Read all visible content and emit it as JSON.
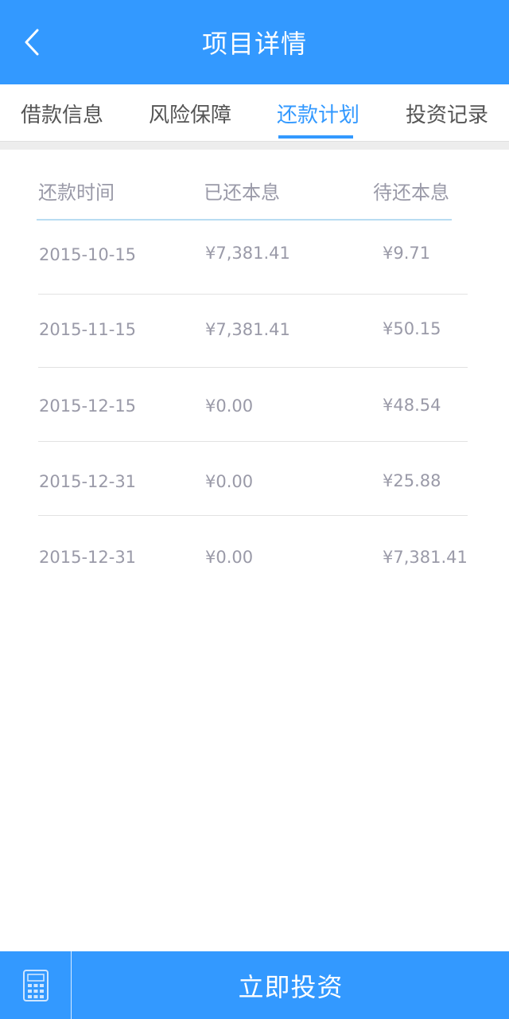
{
  "header": {
    "title": "项目详情",
    "back_icon": "chevron-left-icon"
  },
  "tabs": [
    {
      "label": "借款信息",
      "active": false
    },
    {
      "label": "风险保障",
      "active": false
    },
    {
      "label": "还款计划",
      "active": true
    },
    {
      "label": "投资记录",
      "active": false
    }
  ],
  "table": {
    "columns": [
      "还款时间",
      "已还本息",
      "待还本息"
    ],
    "rows": [
      {
        "date": "2015-10-15",
        "paid": "¥7,381.41",
        "pending": "¥9.71"
      },
      {
        "date": "2015-11-15",
        "paid": "¥7,381.41",
        "pending": "¥50.15"
      },
      {
        "date": "2015-12-15",
        "paid": "¥0.00",
        "pending": "¥48.54"
      },
      {
        "date": "2015-12-31",
        "paid": "¥0.00",
        "pending": "¥25.88"
      },
      {
        "date": "2015-12-31",
        "paid": "¥0.00",
        "pending": "¥7,381.41"
      }
    ]
  },
  "footer": {
    "calculator_icon": "calculator-icon",
    "invest_label": "立即投资"
  },
  "colors": {
    "accent": "#3399ff",
    "text_muted": "#9a9aa8",
    "tab_text": "#555555"
  }
}
